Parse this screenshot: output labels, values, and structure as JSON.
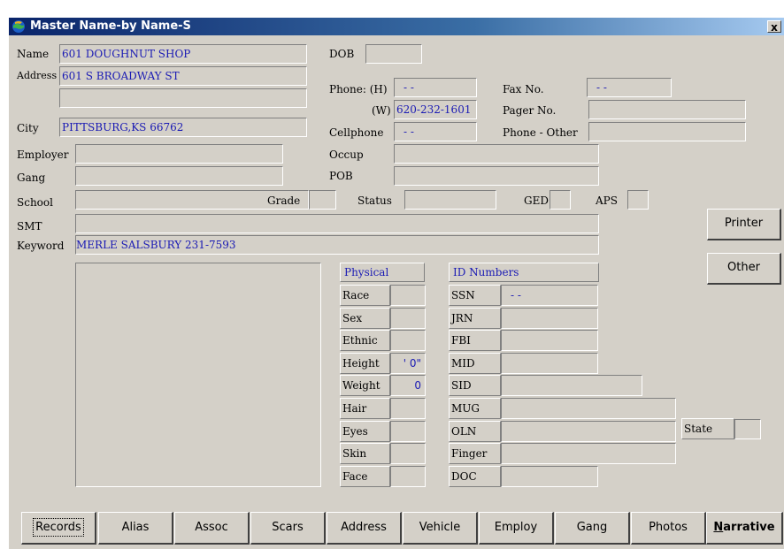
{
  "window": {
    "title": "Master Name-by Name-S",
    "close_label": "x"
  },
  "name_label": "Name",
  "name_value": "601 DOUGHNUT SHOP",
  "address_label": "Address",
  "address_line1": "601 S BROADWAY ST",
  "address_line2": "",
  "city_label": "City",
  "city_value": "PITTSBURG,KS 66762",
  "dob_label": "DOB",
  "dob_value": "",
  "phone_h_label": "Phone: (H)",
  "phone_h_value": "- -",
  "phone_w_label": "(W)",
  "phone_w_value": "620-232-1601",
  "cellphone_label": "Cellphone",
  "cellphone_value": "- -",
  "fax_label": "Fax No.",
  "fax_value": "- -",
  "pager_label": "Pager No.",
  "pager_value": "",
  "phone_other_label": "Phone - Other",
  "phone_other_value": "",
  "employer_label": "Employer",
  "employer_value": "",
  "occup_label": "Occup",
  "occup_value": "",
  "gang_label": "Gang",
  "gang_value": "",
  "pob_label": "POB",
  "pob_value": "",
  "school_label": "School",
  "school_value": "",
  "grade_label": "Grade",
  "grade_value": "",
  "status_label": "Status",
  "status_value": "",
  "ged_label": "GED",
  "ged_value": "",
  "aps_label": "APS",
  "aps_value": "",
  "smt_label": "SMT",
  "smt_value": "",
  "keyword_label": "Keyword",
  "keyword_value": "MERLE SALSBURY 231-7593",
  "printer_label": "Printer",
  "other_label": "Other",
  "physical": {
    "header": "Physical",
    "rows": [
      {
        "label": "Race",
        "value": ""
      },
      {
        "label": "Sex",
        "value": ""
      },
      {
        "label": "Ethnic",
        "value": ""
      },
      {
        "label": "Height",
        "value": "' 0\""
      },
      {
        "label": "Weight",
        "value": "0"
      },
      {
        "label": "Hair",
        "value": ""
      },
      {
        "label": "Eyes",
        "value": ""
      },
      {
        "label": "Skin",
        "value": ""
      },
      {
        "label": "Face",
        "value": ""
      }
    ]
  },
  "id_numbers": {
    "header": "ID Numbers",
    "rows": [
      {
        "label": "SSN",
        "value": "- -"
      },
      {
        "label": "JRN",
        "value": ""
      },
      {
        "label": "FBI",
        "value": ""
      },
      {
        "label": "MID",
        "value": ""
      },
      {
        "label": "SID",
        "value": ""
      },
      {
        "label": "MUG",
        "value": ""
      },
      {
        "label": "OLN",
        "value": ""
      },
      {
        "label": "Finger",
        "value": ""
      },
      {
        "label": "DOC",
        "value": ""
      }
    ],
    "state_label": "State",
    "state_value": ""
  },
  "tabs": [
    "Records",
    "Alias",
    "Assoc",
    "Scars",
    "Address",
    "Vehicle",
    "Employ",
    "Gang",
    "Photos",
    "Narrative"
  ]
}
